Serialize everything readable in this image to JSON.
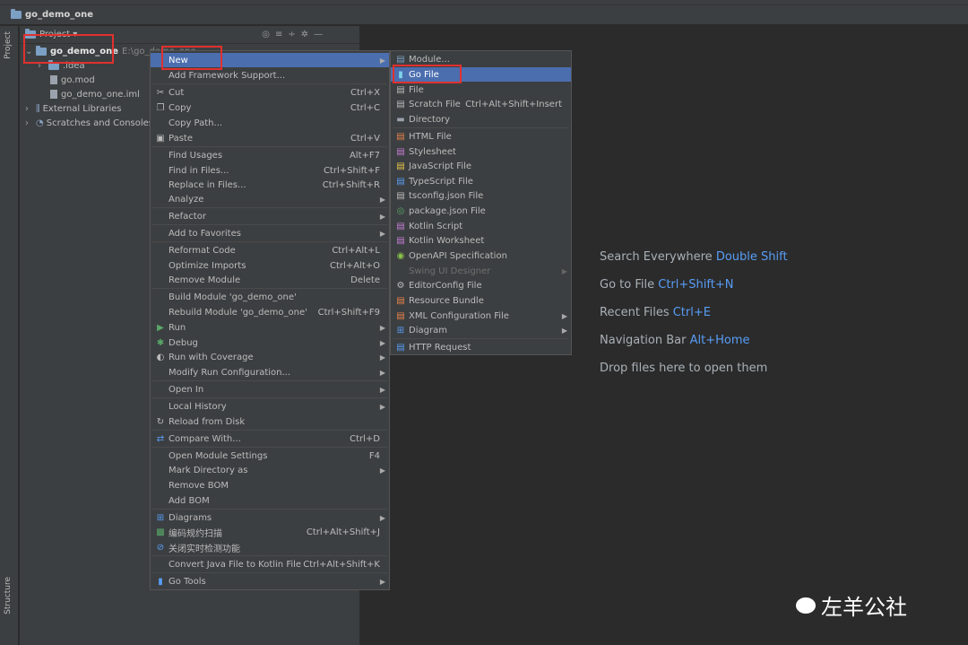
{
  "window": {
    "title": "go_demo_one"
  },
  "side_tabs": {
    "project": "Project",
    "structure": "Structure"
  },
  "project_panel": {
    "title": "Project",
    "dropdown": "▾"
  },
  "tree": [
    {
      "label": "go_demo_one",
      "path": "E:\\go_demo_one"
    },
    {
      "label": ".idea"
    },
    {
      "label": "go.mod"
    },
    {
      "label": "go_demo_one.iml"
    },
    {
      "label": "External Libraries"
    },
    {
      "label": "Scratches and Consoles"
    }
  ],
  "context_menu": [
    {
      "label": "New",
      "shortcut": "",
      "submenu": true
    },
    {
      "label": "Add Framework Support...",
      "shortcut": ""
    },
    {
      "label": "Cut",
      "shortcut": "Ctrl+X",
      "icon": "✂"
    },
    {
      "label": "Copy",
      "shortcut": "Ctrl+C",
      "icon": "❐"
    },
    {
      "label": "Copy Path...",
      "shortcut": ""
    },
    {
      "label": "Paste",
      "shortcut": "Ctrl+V",
      "icon": "▣"
    },
    {
      "label": "Find Usages",
      "shortcut": "Alt+F7"
    },
    {
      "label": "Find in Files...",
      "shortcut": "Ctrl+Shift+F"
    },
    {
      "label": "Replace in Files...",
      "shortcut": "Ctrl+Shift+R"
    },
    {
      "label": "Analyze",
      "shortcut": "",
      "submenu": true
    },
    {
      "label": "Refactor",
      "shortcut": "",
      "submenu": true
    },
    {
      "label": "Add to Favorites",
      "shortcut": "",
      "submenu": true
    },
    {
      "label": "Reformat Code",
      "shortcut": "Ctrl+Alt+L"
    },
    {
      "label": "Optimize Imports",
      "shortcut": "Ctrl+Alt+O"
    },
    {
      "label": "Remove Module",
      "shortcut": "Delete"
    },
    {
      "label": "Build Module 'go_demo_one'",
      "shortcut": ""
    },
    {
      "label": "Rebuild Module 'go_demo_one'",
      "shortcut": "Ctrl+Shift+F9"
    },
    {
      "label": "Run",
      "shortcut": "",
      "submenu": true,
      "icon": "▶"
    },
    {
      "label": "Debug",
      "shortcut": "",
      "submenu": true,
      "icon": "✱"
    },
    {
      "label": "Run with Coverage",
      "shortcut": "",
      "submenu": true,
      "icon": "◐"
    },
    {
      "label": "Modify Run Configuration...",
      "shortcut": "",
      "submenu": true
    },
    {
      "label": "Open In",
      "shortcut": "",
      "submenu": true
    },
    {
      "label": "Local History",
      "shortcut": "",
      "submenu": true
    },
    {
      "label": "Reload from Disk",
      "shortcut": "",
      "icon": "↻"
    },
    {
      "label": "Compare With...",
      "shortcut": "Ctrl+D",
      "icon": "⇄"
    },
    {
      "label": "Open Module Settings",
      "shortcut": "F4"
    },
    {
      "label": "Mark Directory as",
      "shortcut": "",
      "submenu": true
    },
    {
      "label": "Remove BOM",
      "shortcut": ""
    },
    {
      "label": "Add BOM",
      "shortcut": ""
    },
    {
      "label": "Diagrams",
      "shortcut": "",
      "submenu": true,
      "icon": "⊞"
    },
    {
      "label": "编码规约扫描",
      "shortcut": "Ctrl+Alt+Shift+J",
      "icon": "▩"
    },
    {
      "label": "关闭实时检测功能",
      "shortcut": "",
      "icon": "⊘"
    },
    {
      "label": "Convert Java File to Kotlin File",
      "shortcut": "Ctrl+Alt+Shift+K"
    },
    {
      "label": "Go Tools",
      "shortcut": "",
      "submenu": true,
      "icon": "▮"
    }
  ],
  "new_submenu": [
    {
      "label": "Module...",
      "icon": "▤"
    },
    {
      "label": "Go File",
      "icon": "▮"
    },
    {
      "label": "File",
      "icon": "▤"
    },
    {
      "label": "Scratch File",
      "shortcut": "Ctrl+Alt+Shift+Insert",
      "icon": "▤"
    },
    {
      "label": "Directory",
      "icon": "▬"
    },
    {
      "label": "HTML File",
      "icon": "▤"
    },
    {
      "label": "Stylesheet",
      "icon": "▤"
    },
    {
      "label": "JavaScript File",
      "icon": "▤"
    },
    {
      "label": "TypeScript File",
      "icon": "▤"
    },
    {
      "label": "tsconfig.json File",
      "icon": "▤"
    },
    {
      "label": "package.json File",
      "icon": "◎"
    },
    {
      "label": "Kotlin Script",
      "icon": "▤"
    },
    {
      "label": "Kotlin Worksheet",
      "icon": "▤"
    },
    {
      "label": "OpenAPI Specification",
      "icon": "◉"
    },
    {
      "label": "Swing UI Designer",
      "disabled": true,
      "submenu": true
    },
    {
      "label": "EditorConfig File",
      "icon": "⚙"
    },
    {
      "label": "Resource Bundle",
      "icon": "▤"
    },
    {
      "label": "XML Configuration File",
      "submenu": true,
      "icon": "▤"
    },
    {
      "label": "Diagram",
      "submenu": true,
      "icon": "⊞"
    },
    {
      "label": "HTTP Request",
      "icon": "▤"
    }
  ],
  "editor_hints": [
    {
      "text": "Search Everywhere",
      "key": "Double Shift"
    },
    {
      "text": "Go to File",
      "key": "Ctrl+Shift+N"
    },
    {
      "text": "Recent Files",
      "key": "Ctrl+E"
    },
    {
      "text": "Navigation Bar",
      "key": "Alt+Home"
    },
    {
      "text": "Drop files here to open them",
      "key": ""
    }
  ],
  "watermark": {
    "text": "左羊公社"
  },
  "colors": {
    "selection": "#4b6eaf",
    "highlight_box": "#e0312f",
    "hint_key": "#589df6"
  }
}
